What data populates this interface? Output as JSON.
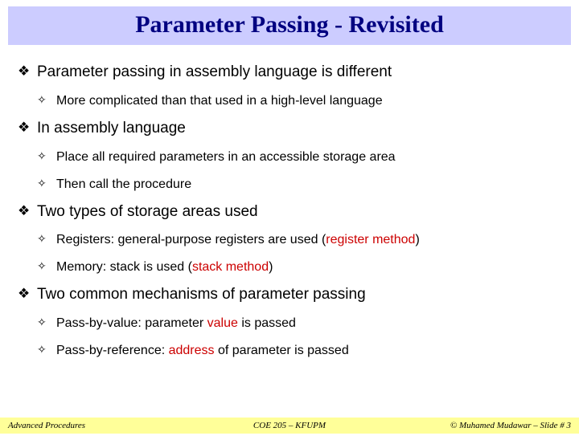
{
  "title": "Parameter Passing - Revisited",
  "bullets": {
    "b1": "Parameter passing in assembly language is different",
    "b1_1": "More complicated than that used in a high-level language",
    "b2": "In assembly language",
    "b2_1": "Place all required parameters in an accessible storage area",
    "b2_2": "Then call the procedure",
    "b3": "Two types of storage areas used",
    "b3_1a": "Registers: general-purpose registers are used (",
    "b3_1b": "register method",
    "b3_1c": ")",
    "b3_2a": "Memory: stack is used (",
    "b3_2b": "stack method",
    "b3_2c": ")",
    "b4": "Two common mechanisms of parameter passing",
    "b4_1a": "Pass-by-value: parameter ",
    "b4_1b": "value",
    "b4_1c": " is passed",
    "b4_2a": "Pass-by-reference: ",
    "b4_2b": "address",
    "b4_2c": " of parameter is passed"
  },
  "footer": {
    "left": "Advanced Procedures",
    "center": "COE 205 – KFUPM",
    "right": "© Muhamed Mudawar – Slide # 3"
  }
}
